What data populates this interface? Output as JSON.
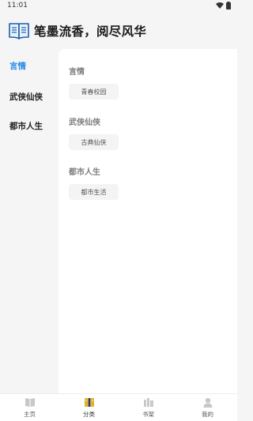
{
  "status_bar": {
    "time": "11:01"
  },
  "header": {
    "title": "笔墨流香，阅尽风华",
    "logo_icon": "open-book-icon"
  },
  "sidebar": {
    "items": [
      {
        "label": "言情",
        "active": true
      },
      {
        "label": "武侠仙侠",
        "active": false
      },
      {
        "label": "都市人生",
        "active": false
      }
    ]
  },
  "sections": [
    {
      "title": "言情",
      "chips": [
        "青春校园"
      ]
    },
    {
      "title": "武侠仙侠",
      "chips": [
        "古典仙侠"
      ]
    },
    {
      "title": "都市人生",
      "chips": [
        "都市生活"
      ]
    }
  ],
  "bottom_nav": [
    {
      "label": "主页",
      "icon": "home-book-icon",
      "active": false
    },
    {
      "label": "分类",
      "icon": "category-books-icon",
      "active": true
    },
    {
      "label": "书架",
      "icon": "bookshelf-icon",
      "active": false
    },
    {
      "label": "我的",
      "icon": "user-icon",
      "active": false
    }
  ],
  "colors": {
    "accent": "#2c8ce8",
    "background": "#f5f5f5",
    "panel": "#ffffff",
    "chip_bg": "#f4f4f4",
    "active_nav_icon": "#e0b32a"
  }
}
